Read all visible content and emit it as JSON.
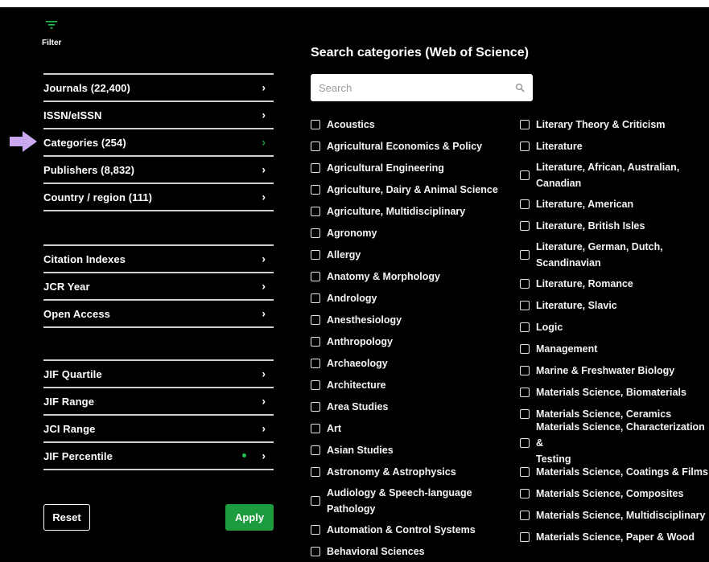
{
  "filter": {
    "label": "Filter",
    "icon": "filter-icon"
  },
  "sidebar": {
    "group1": [
      {
        "label": "Journals (22,400)",
        "name": "sidebar-item-journals"
      },
      {
        "label": "ISSN/eISSN",
        "name": "sidebar-item-issn"
      },
      {
        "label": "Categories (254)",
        "name": "sidebar-item-categories",
        "active": true
      },
      {
        "label": "Publishers (8,832)",
        "name": "sidebar-item-publishers"
      },
      {
        "label": "Country / region (111)",
        "name": "sidebar-item-country-region"
      }
    ],
    "group2": [
      {
        "label": "Citation Indexes",
        "name": "sidebar-item-citation-indexes"
      },
      {
        "label": "JCR Year",
        "name": "sidebar-item-jcr-year"
      },
      {
        "label": "Open Access",
        "name": "sidebar-item-open-access"
      }
    ],
    "group3": [
      {
        "label": "JIF Quartile",
        "name": "sidebar-item-jif-quartile"
      },
      {
        "label": "JIF Range",
        "name": "sidebar-item-jif-range"
      },
      {
        "label": "JCI Range",
        "name": "sidebar-item-jci-range"
      },
      {
        "label": "JIF Percentile",
        "name": "sidebar-item-jif-percentile",
        "dot": true
      }
    ],
    "reset_label": "Reset",
    "apply_label": "Apply"
  },
  "main": {
    "title": "Search categories (Web of Science)",
    "search_placeholder": "Search",
    "categories_col1": [
      [
        "Acoustics"
      ],
      [
        "Agricultural Economics & Policy"
      ],
      [
        "Agricultural Engineering"
      ],
      [
        "Agriculture, Dairy & Animal Science"
      ],
      [
        "Agriculture, Multidisciplinary"
      ],
      [
        "Agronomy"
      ],
      [
        "Allergy"
      ],
      [
        "Anatomy & Morphology"
      ],
      [
        "Andrology"
      ],
      [
        "Anesthesiology"
      ],
      [
        "Anthropology"
      ],
      [
        "Archaeology"
      ],
      [
        "Architecture"
      ],
      [
        "Area Studies"
      ],
      [
        "Art"
      ],
      [
        "Asian Studies"
      ],
      [
        "Astronomy & Astrophysics"
      ],
      [
        "Audiology & Speech-language",
        "Pathology"
      ],
      [
        "Automation & Control Systems"
      ],
      [
        "Behavioral Sciences"
      ]
    ],
    "categories_col2": [
      [
        "Literary Theory & Criticism"
      ],
      [
        "Literature"
      ],
      [
        "Literature, African, Australian,",
        "Canadian"
      ],
      [
        "Literature, American"
      ],
      [
        "Literature, British Isles"
      ],
      [
        "Literature, German, Dutch,",
        "Scandinavian"
      ],
      [
        "Literature, Romance"
      ],
      [
        "Literature, Slavic"
      ],
      [
        "Logic"
      ],
      [
        "Management"
      ],
      [
        "Marine & Freshwater Biology"
      ],
      [
        "Materials Science, Biomaterials"
      ],
      [
        "Materials Science, Ceramics"
      ],
      [
        "Materials Science, Characterization &",
        "Testing"
      ],
      [
        "Materials Science, Coatings & Films"
      ],
      [
        "Materials Science, Composites"
      ],
      [
        "Materials Science, Multidisciplinary"
      ],
      [
        "Materials Science, Paper & Wood"
      ]
    ]
  },
  "colors": {
    "accent_green": "#1d9c3f",
    "indicator_arrow": "#c9a8f0",
    "divider": "#cfcfcf"
  }
}
